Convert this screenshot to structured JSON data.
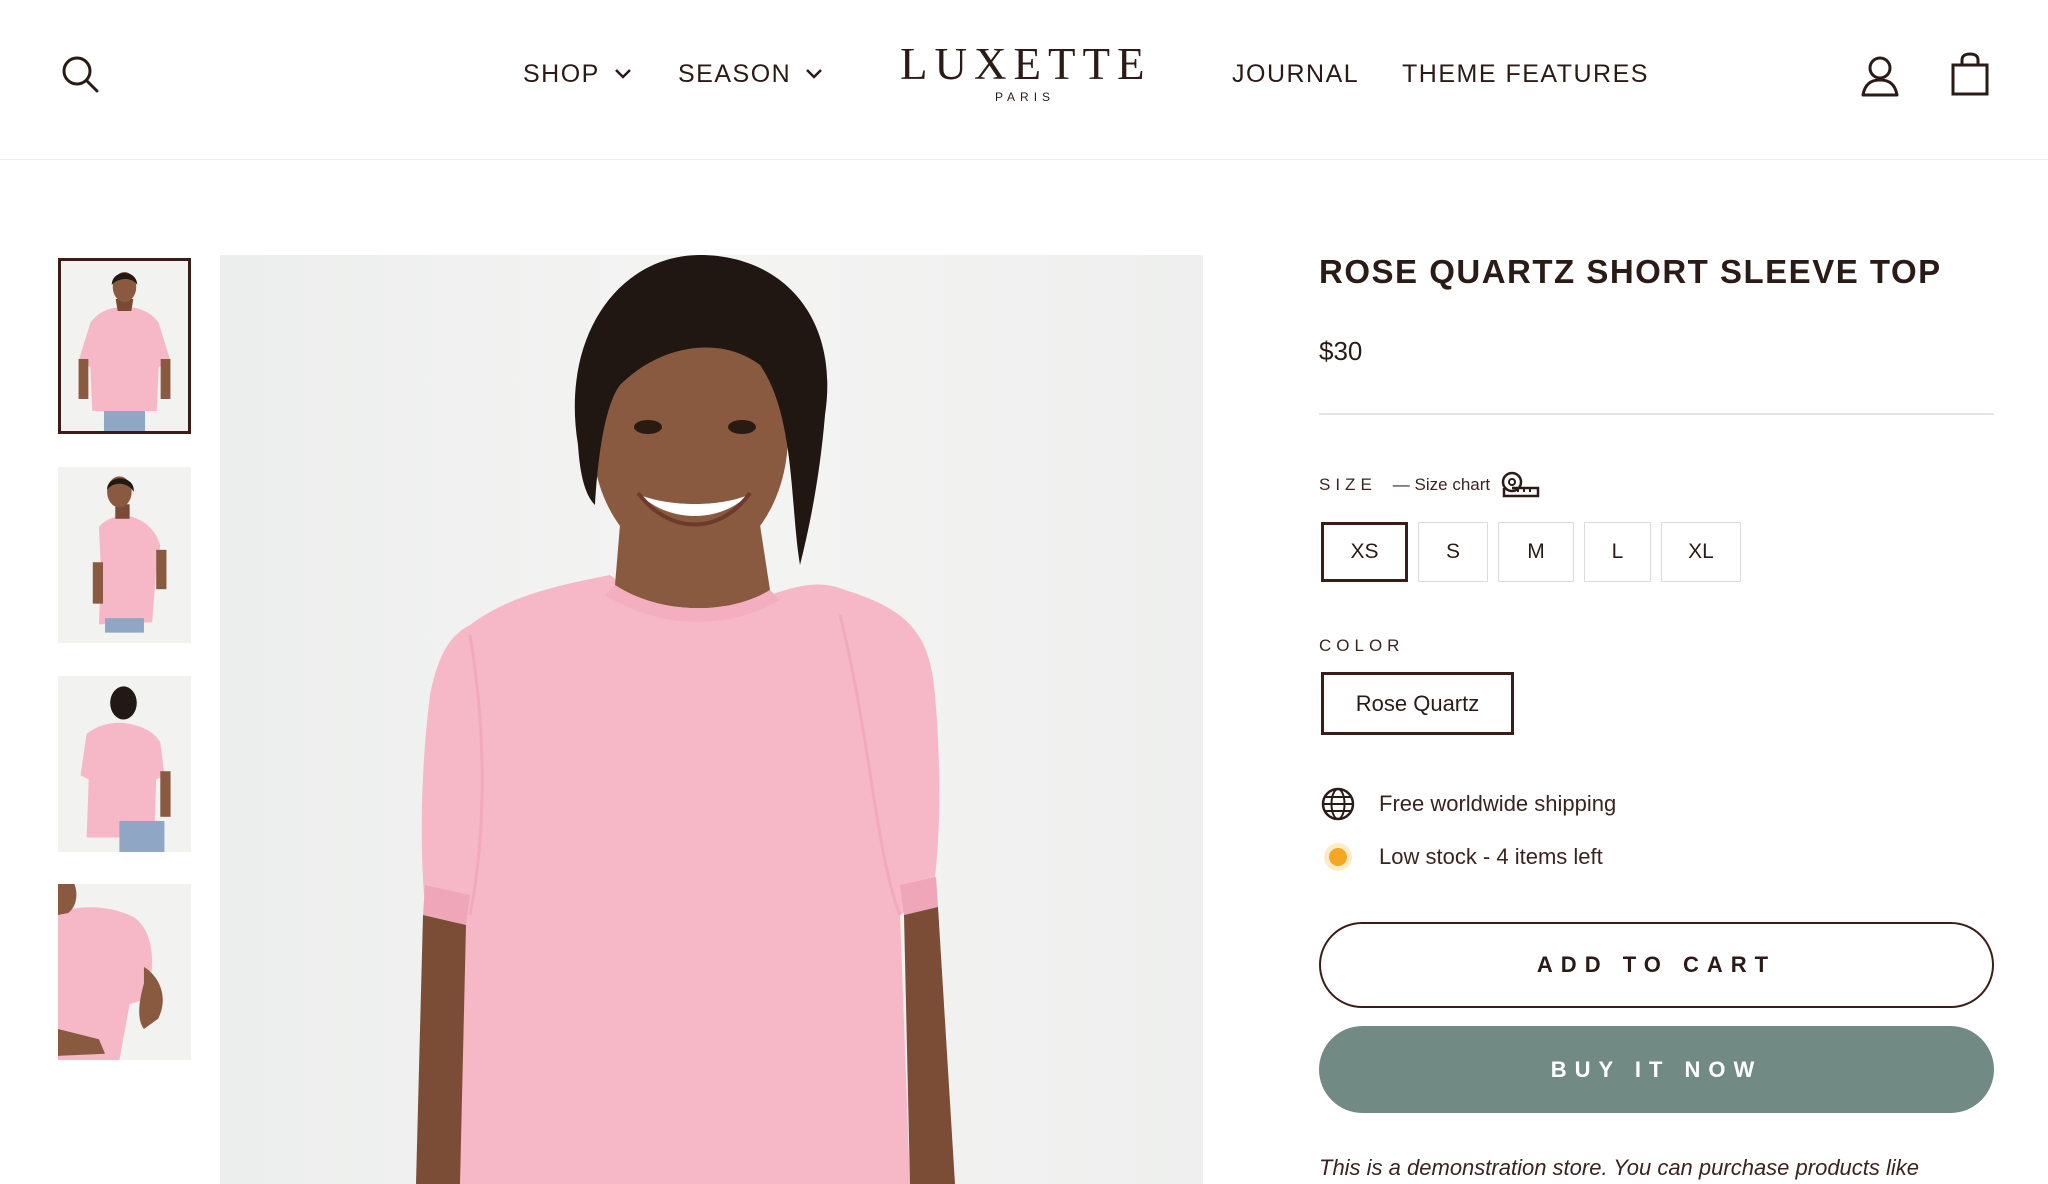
{
  "header": {
    "nav_left": [
      {
        "label": "SHOP",
        "has_dropdown": true
      },
      {
        "label": "SEASON",
        "has_dropdown": true
      }
    ],
    "logo": {
      "main": "LUXETTE",
      "sub": "PARIS"
    },
    "nav_right": [
      {
        "label": "JOURNAL"
      },
      {
        "label": "THEME FEATURES"
      }
    ],
    "icons": {
      "search": "search-icon",
      "account": "user-icon",
      "cart": "shopping-bag-icon"
    }
  },
  "gallery": {
    "thumbnails": [
      {
        "alt": "front view",
        "active": true
      },
      {
        "alt": "side view",
        "active": false
      },
      {
        "alt": "back view",
        "active": false
      },
      {
        "alt": "sleeve detail",
        "active": false
      }
    ]
  },
  "product": {
    "title": "ROSE QUARTZ SHORT SLEEVE TOP",
    "price": "$30",
    "size": {
      "label": "SIZE",
      "size_chart": "— Size chart",
      "options": [
        "XS",
        "S",
        "M",
        "L",
        "XL"
      ],
      "selected": "XS"
    },
    "color": {
      "label": "COLOR",
      "options": [
        "Rose Quartz"
      ],
      "selected": "Rose Quartz"
    },
    "features": [
      {
        "icon": "globe-icon",
        "text": "Free worldwide shipping"
      },
      {
        "icon": "stock-dot-icon",
        "text": "Low stock - 4 items left"
      }
    ],
    "add_to_cart": "ADD TO CART",
    "buy_now": "BUY IT NOW",
    "demo_notice": "This is a demonstration store. You can purchase products like"
  },
  "colors": {
    "text": "#2b1b17",
    "accent_border": "#3a1d17",
    "buy_button": "#718a83",
    "stock_dot": "#f5a623",
    "product_pink": "#f6b8c6"
  }
}
